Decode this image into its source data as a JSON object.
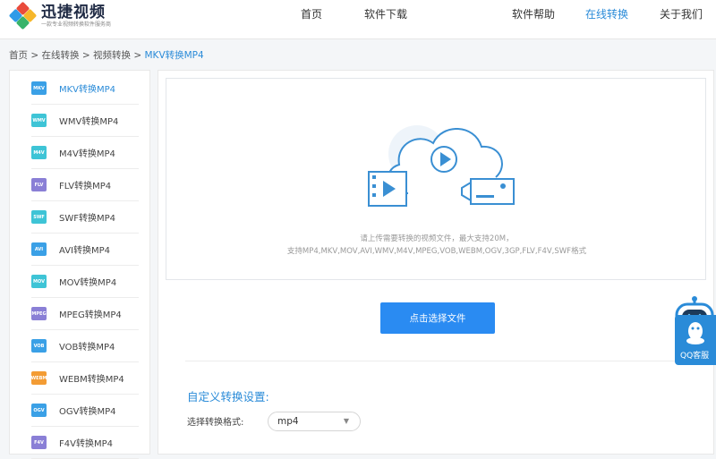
{
  "header": {
    "logo_title": "迅捷视频",
    "logo_subtitle": "一款专业视频转换软件服务商",
    "nav": [
      "首页",
      "软件下载",
      "软件帮助",
      "在线转换",
      "关于我们"
    ],
    "active_nav": "在线转换"
  },
  "breadcrumb": {
    "items": [
      "首页",
      "在线转换",
      "视频转换",
      "MKV转换MP4"
    ],
    "separator": ">"
  },
  "sidebar": {
    "items": [
      {
        "icon": "MKV",
        "label": "MKV转换MP4",
        "color": "#3aa0e6",
        "active": true
      },
      {
        "icon": "WMV",
        "label": "WMV转换MP4",
        "color": "#3ec4d6"
      },
      {
        "icon": "M4V",
        "label": "M4V转换MP4",
        "color": "#3ec4d6"
      },
      {
        "icon": "FLV",
        "label": "FLV转换MP4",
        "color": "#8a7fd6"
      },
      {
        "icon": "SWF",
        "label": "SWF转换MP4",
        "color": "#3ec4d6"
      },
      {
        "icon": "AVI",
        "label": "AVI转换MP4",
        "color": "#3aa0e6"
      },
      {
        "icon": "MOV",
        "label": "MOV转换MP4",
        "color": "#3ec4d6"
      },
      {
        "icon": "MPEG",
        "label": "MPEG转换MP4",
        "color": "#8a7fd6"
      },
      {
        "icon": "VOB",
        "label": "VOB转换MP4",
        "color": "#3aa0e6"
      },
      {
        "icon": "WEBM",
        "label": "WEBM转换MP4",
        "color": "#f39c34"
      },
      {
        "icon": "OGV",
        "label": "OGV转换MP4",
        "color": "#3aa0e6"
      },
      {
        "icon": "F4V",
        "label": "F4V转换MP4",
        "color": "#8a7fd6"
      }
    ]
  },
  "main": {
    "hint_line1": "请上传需要转换的视频文件，最大支持20M，",
    "hint_line2": "支持MP4,MKV,MOV,AVI,WMV,M4V,MPEG,VOB,WEBM,OGV,3GP,FLV,F4V,SWF格式",
    "upload_button": "点击选择文件",
    "settings_title": "自定义转换设置:",
    "format_label": "选择转换格式:",
    "format_value": "mp4"
  },
  "support": {
    "label": "QQ客服"
  },
  "colors": {
    "accent": "#2a8bd8",
    "button": "#2a8bf2"
  }
}
